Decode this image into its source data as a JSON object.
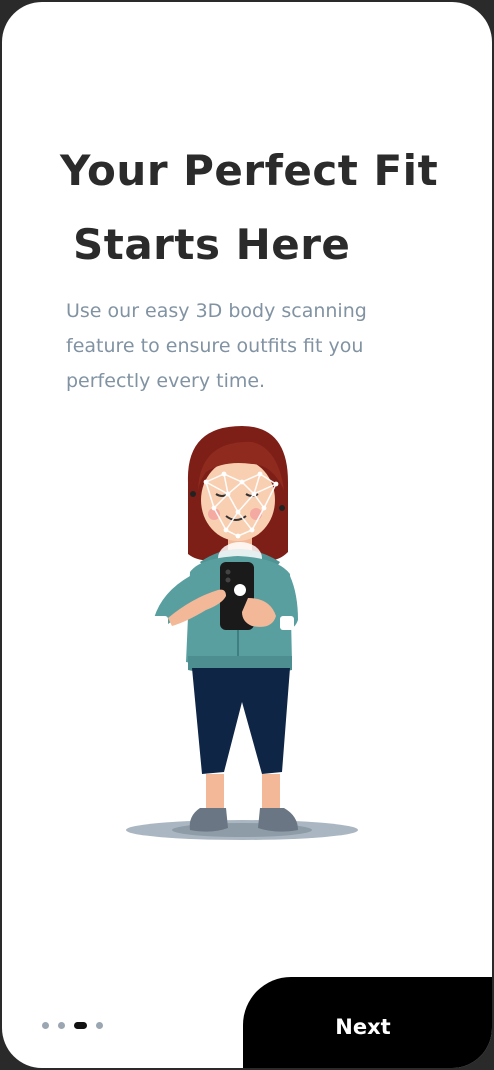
{
  "onboarding": {
    "title_line1": "Your Perfect Fit",
    "title_line2": "Starts Here",
    "subtitle": "Use our easy 3D body scanning feature to ensure outfits fit you perfectly every time.",
    "illustration_icon": "woman-face-scanning-illustration",
    "pagination": {
      "total": 4,
      "active_index": 2
    },
    "next_label": "Next"
  },
  "colors": {
    "background": "#ffffff",
    "title": "#2b2b2b",
    "subtitle": "#8193a3",
    "button_bg": "#000000",
    "button_text": "#ffffff",
    "dot_inactive": "#9aa6b2",
    "dot_active": "#111111"
  }
}
